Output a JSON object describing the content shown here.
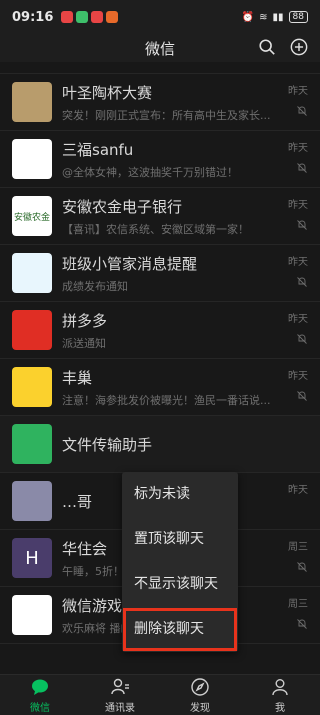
{
  "status_bar": {
    "time": "09:16",
    "battery": "88"
  },
  "header": {
    "title": "微信"
  },
  "chats": [
    {
      "name": "叶圣陶杯大赛",
      "preview": "突发！刚刚正式宣布：所有高中生及家长...",
      "time": "昨天",
      "muted": true,
      "avatar_color": "#b89c6c"
    },
    {
      "name": "三福sanfu",
      "preview": "@全体女神，这波抽奖千万别错过！",
      "time": "昨天",
      "muted": true,
      "avatar_color": "#ffffff"
    },
    {
      "name": "安徽农金电子银行",
      "preview": "【喜讯】农信系统、安徽区域第一家！",
      "time": "昨天",
      "muted": true,
      "avatar_color": "#ffffff",
      "avatar_text": "安徽农金"
    },
    {
      "name": "班级小管家消息提醒",
      "preview": "成绩发布通知",
      "time": "昨天",
      "muted": true,
      "avatar_color": "#e8f6fd"
    },
    {
      "name": "拼多多",
      "preview": "派送通知",
      "time": "昨天",
      "muted": true,
      "avatar_color": "#e02e24"
    },
    {
      "name": "丰巢",
      "preview": "注意！海参批发价被曝光！渔民一番话说...",
      "time": "昨天",
      "muted": true,
      "avatar_color": "#fbd12d"
    },
    {
      "name": "文件传输助手",
      "preview": "",
      "time": "",
      "muted": false,
      "avatar_color": "#2fb35f"
    },
    {
      "name": "…哥",
      "preview": "",
      "time": "昨天",
      "muted": false,
      "avatar_color": "#8a8aa8"
    },
    {
      "name": "华住会",
      "preview": "午睡，5折！",
      "time": "周三",
      "muted": true,
      "avatar_color": "#4a3d6b",
      "avatar_text": "H"
    },
    {
      "name": "微信游戏",
      "preview": "欢乐麻将 播邮件",
      "time": "周三",
      "muted": true,
      "avatar_color": "#ffffff"
    }
  ],
  "context_menu": {
    "items": [
      "标为未读",
      "置顶该聊天",
      "不显示该聊天",
      "删除该聊天"
    ],
    "highlighted_index": 3,
    "highlight_color": "#e8331c"
  },
  "tabbar": {
    "tabs": [
      {
        "label": "微信",
        "icon": "chat-icon",
        "active": true
      },
      {
        "label": "通讯录",
        "icon": "contacts-icon",
        "active": false
      },
      {
        "label": "发现",
        "icon": "compass-icon",
        "active": false
      },
      {
        "label": "我",
        "icon": "person-icon",
        "active": false
      }
    ],
    "active_color": "#07c160"
  }
}
